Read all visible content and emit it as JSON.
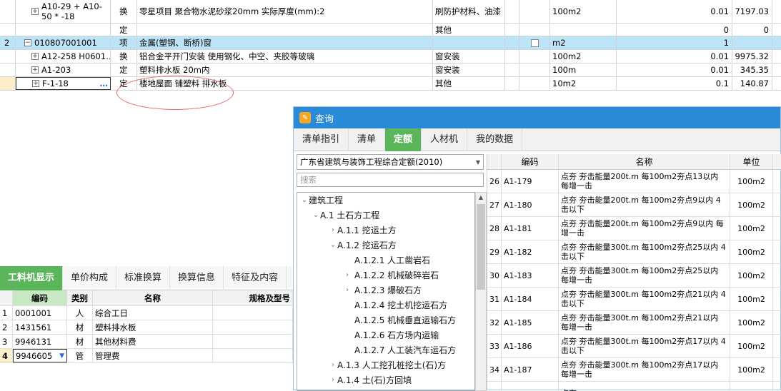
{
  "top_rows": [
    {
      "num": "",
      "code": "A10-29 + A10-50 * -18",
      "type": "换",
      "name": "零星项目 聚合物水泥砂浆20mm  实际厚度(mm):2",
      "cat": "刷防护材料、油漆",
      "unit": "100m2",
      "qty": "0.01",
      "price": "7197.03"
    },
    {
      "num": "",
      "code": "",
      "type": "定",
      "name": "",
      "cat": "其他",
      "unit": "",
      "qty": "0",
      "price": "0"
    },
    {
      "num": "2",
      "code": "010807001001",
      "type": "项",
      "name": "金属(塑钢、断桥)窗",
      "cat": "",
      "unit": "m2",
      "qty": "1",
      "price": ""
    },
    {
      "num": "",
      "code": "A12-258 H0601…",
      "type": "换",
      "name": "铝合金平开门安装  使用钢化、中空、夹胶等玻璃",
      "cat": "窗安装",
      "unit": "100m2",
      "qty": "0.01",
      "price": "9975.32"
    },
    {
      "num": "",
      "code": "A1-203",
      "type": "定",
      "name": "塑料排水板 20m内",
      "cat": "窗安装",
      "unit": "100m",
      "qty": "0.01",
      "price": "345.35"
    },
    {
      "num": "",
      "code": "F-1-18",
      "type": "定",
      "name": "楼地屋面 铺塑料 排水板",
      "cat": "其他",
      "unit": "10m2",
      "qty": "0.1",
      "price": "140.87"
    }
  ],
  "bottom": {
    "tabs": [
      "工料机显示",
      "单价构成",
      "标准换算",
      "换算信息",
      "特征及内容"
    ],
    "headers": {
      "code": "编码",
      "type": "类别",
      "name": "名称",
      "spec": "规格及型号"
    },
    "rows": [
      {
        "num": "1",
        "code": "0001001",
        "type": "人",
        "name": "综合工日"
      },
      {
        "num": "2",
        "code": "1431561",
        "type": "材",
        "name": "塑料排水板"
      },
      {
        "num": "3",
        "code": "9946131",
        "type": "材",
        "name": "其他材料费"
      },
      {
        "num": "4",
        "code": "9946605",
        "type": "管",
        "name": "管理费"
      }
    ]
  },
  "dialog": {
    "title": "查询",
    "tabs": [
      "清单指引",
      "清单",
      "定额",
      "人材机",
      "我的数据"
    ],
    "library": "广东省建筑与装饰工程综合定额(2010)",
    "search_placeholder": "搜索",
    "tree": [
      {
        "label": "建筑工程",
        "state": "open",
        "depth": 0
      },
      {
        "label": "A.1 土石方工程",
        "state": "open",
        "depth": 1
      },
      {
        "label": "A.1.1 挖运土方",
        "state": "closed",
        "depth": 2
      },
      {
        "label": "A.1.2 挖运石方",
        "state": "open",
        "depth": 2
      },
      {
        "label": "A.1.2.1 人工凿岩石",
        "state": "leaf",
        "depth": 3
      },
      {
        "label": "A.1.2.2 机械破碎岩石",
        "state": "closed",
        "depth": 3
      },
      {
        "label": "A.1.2.3 爆破石方",
        "state": "closed",
        "depth": 3
      },
      {
        "label": "A.1.2.4 挖土机挖运石方",
        "state": "leaf",
        "depth": 3
      },
      {
        "label": "A.1.2.5 机械垂直运输石方",
        "state": "leaf",
        "depth": 3
      },
      {
        "label": "A.1.2.6 石方场内运输",
        "state": "leaf",
        "depth": 3
      },
      {
        "label": "A.1.2.7 人工装汽车运石方",
        "state": "leaf",
        "depth": 3
      },
      {
        "label": "A.1.3 人工挖孔桩挖土(石)方",
        "state": "closed",
        "depth": 2
      },
      {
        "label": "A.1.4 土(石)方回填",
        "state": "closed",
        "depth": 2
      }
    ],
    "table_headers": {
      "code": "编码",
      "name": "名称",
      "unit": "单位"
    },
    "rows": [
      {
        "num": "26",
        "code": "A1-179",
        "name": "点夯 夯击能量200t.m 每100m2夯点13以内 每增一击",
        "unit": "100m2"
      },
      {
        "num": "27",
        "code": "A1-180",
        "name": "点夯 夯击能量200t.m 每100m2夯点9以内 4击以下",
        "unit": "100m2"
      },
      {
        "num": "28",
        "code": "A1-181",
        "name": "点夯 夯击能量200t.m 每100m2夯点9以内 每增一击",
        "unit": "100m2"
      },
      {
        "num": "29",
        "code": "A1-182",
        "name": "点夯 夯击能量300t.m 每100m2夯点25以内 4击以下",
        "unit": "100m2"
      },
      {
        "num": "30",
        "code": "A1-183",
        "name": "点夯 夯击能量300t.m 每100m2夯点25以内 每增一击",
        "unit": "100m2"
      },
      {
        "num": "31",
        "code": "A1-184",
        "name": "点夯 夯击能量300t.m 每100m2夯点21以内 4击以下",
        "unit": "100m2"
      },
      {
        "num": "32",
        "code": "A1-185",
        "name": "点夯 夯击能量300t.m 每100m2夯点21以内 每增一击",
        "unit": "100m2"
      },
      {
        "num": "33",
        "code": "A1-186",
        "name": "点夯 夯击能量300t.m 每100m2夯点17以内 4击以下",
        "unit": "100m2"
      },
      {
        "num": "34",
        "code": "A1-187",
        "name": "点夯 夯击能量300t.m 每100m2夯点17以内 每增一击",
        "unit": "100m2"
      },
      {
        "num": "",
        "code": "",
        "name": "点夯",
        "unit": ""
      }
    ]
  },
  "colors": {
    "accent": "#5bb55b",
    "title_bar": "#2a8ad8",
    "selected_row": "#bde3f6",
    "annotation": "#e36b6b"
  }
}
